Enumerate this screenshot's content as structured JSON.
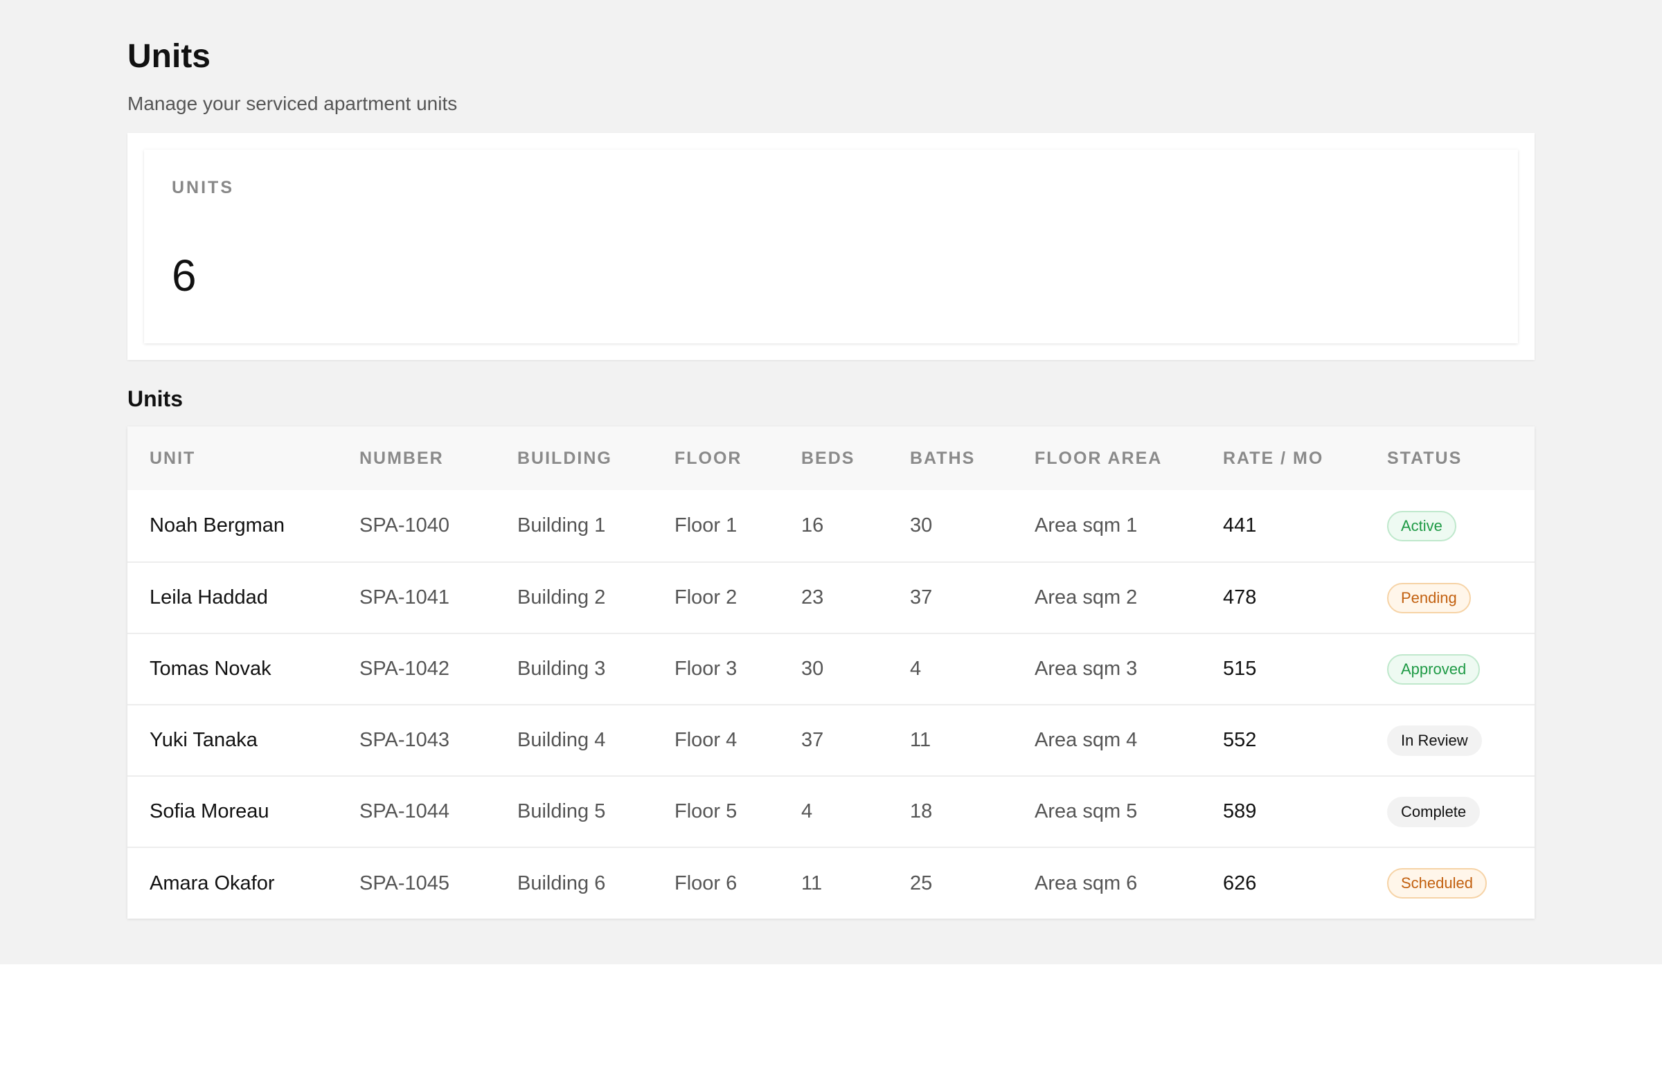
{
  "header": {
    "title": "Units",
    "subtitle": "Manage your serviced apartment units"
  },
  "stats": {
    "label": "UNITS",
    "value": "6"
  },
  "table": {
    "section_title": "Units",
    "columns": [
      "UNIT",
      "NUMBER",
      "BUILDING",
      "FLOOR",
      "BEDS",
      "BATHS",
      "FLOOR AREA",
      "RATE / MO",
      "STATUS"
    ],
    "rows": [
      {
        "unit": "Noah Bergman",
        "number": "SPA-1040",
        "building": "Building 1",
        "floor": "Floor 1",
        "beds": "16",
        "baths": "30",
        "area": "Area sqm 1",
        "rate": "441",
        "status": "Active",
        "status_tone": "green"
      },
      {
        "unit": "Leila Haddad",
        "number": "SPA-1041",
        "building": "Building 2",
        "floor": "Floor 2",
        "beds": "23",
        "baths": "37",
        "area": "Area sqm 2",
        "rate": "478",
        "status": "Pending",
        "status_tone": "orange"
      },
      {
        "unit": "Tomas Novak",
        "number": "SPA-1042",
        "building": "Building 3",
        "floor": "Floor 3",
        "beds": "30",
        "baths": "4",
        "area": "Area sqm 3",
        "rate": "515",
        "status": "Approved",
        "status_tone": "green"
      },
      {
        "unit": "Yuki Tanaka",
        "number": "SPA-1043",
        "building": "Building 4",
        "floor": "Floor 4",
        "beds": "37",
        "baths": "11",
        "area": "Area sqm 4",
        "rate": "552",
        "status": "In Review",
        "status_tone": "gray"
      },
      {
        "unit": "Sofia Moreau",
        "number": "SPA-1044",
        "building": "Building 5",
        "floor": "Floor 5",
        "beds": "4",
        "baths": "18",
        "area": "Area sqm 5",
        "rate": "589",
        "status": "Complete",
        "status_tone": "gray"
      },
      {
        "unit": "Amara Okafor",
        "number": "SPA-1045",
        "building": "Building 6",
        "floor": "Floor 6",
        "beds": "11",
        "baths": "25",
        "area": "Area sqm 6",
        "rate": "626",
        "status": "Scheduled",
        "status_tone": "orange"
      }
    ]
  },
  "colors": {
    "background": "#f2f2f2",
    "status_green": "#1e9a45",
    "status_orange": "#c2600f"
  }
}
